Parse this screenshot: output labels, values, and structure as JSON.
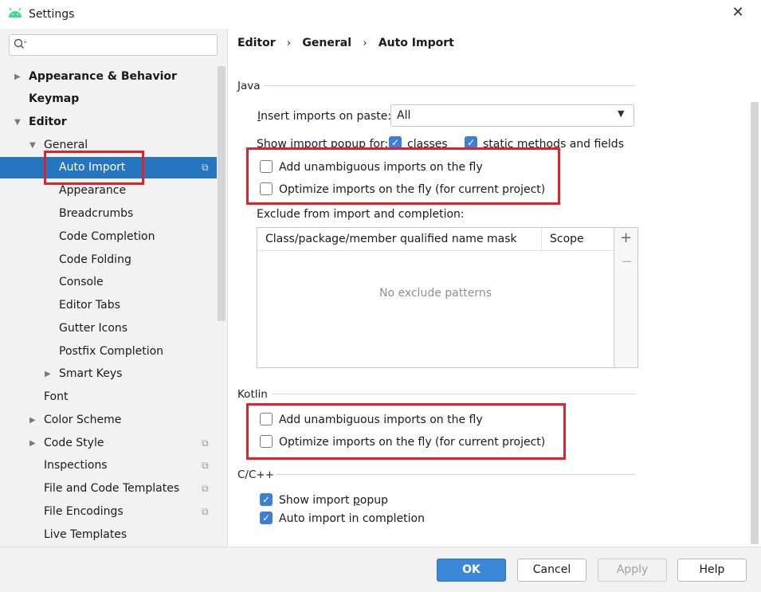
{
  "window": {
    "title": "Settings"
  },
  "search": {
    "placeholder": ""
  },
  "sidebar": {
    "items": [
      {
        "label": "Appearance & Behavior"
      },
      {
        "label": "Keymap"
      },
      {
        "label": "Editor"
      },
      {
        "label": "General"
      },
      {
        "label": "Auto Import"
      },
      {
        "label": "Appearance"
      },
      {
        "label": "Breadcrumbs"
      },
      {
        "label": "Code Completion"
      },
      {
        "label": "Code Folding"
      },
      {
        "label": "Console"
      },
      {
        "label": "Editor Tabs"
      },
      {
        "label": "Gutter Icons"
      },
      {
        "label": "Postfix Completion"
      },
      {
        "label": "Smart Keys"
      },
      {
        "label": "Font"
      },
      {
        "label": "Color Scheme"
      },
      {
        "label": "Code Style"
      },
      {
        "label": "Inspections"
      },
      {
        "label": "File and Code Templates"
      },
      {
        "label": "File Encodings"
      },
      {
        "label": "Live Templates"
      }
    ]
  },
  "breadcrumb": {
    "part1": "Editor",
    "part2": "General",
    "part3": "Auto Import",
    "sep": "›"
  },
  "java": {
    "section": "Java",
    "insert_on_paste_prefix": "I",
    "insert_on_paste_rest": "nsert imports on paste:",
    "insert_on_paste_value": "All",
    "popup_label": "Show import popup for:",
    "popup_classes": "classes",
    "popup_static": "static methods and fields",
    "add_unambiguous": "Add unambiguous imports on the fly",
    "optimize": "Optimize imports on the fly (for current project)",
    "exclude_label": "Exclude from import and completion:",
    "table_col1": "Class/package/member qualified name mask",
    "table_col2": "Scope",
    "table_empty": "No exclude patterns"
  },
  "kotlin": {
    "section": "Kotlin",
    "add_unambiguous": "Add unambiguous imports on the fly",
    "optimize": "Optimize imports on the fly (for current project)"
  },
  "cpp": {
    "section": "C/C++",
    "show_popup_prefix": "Show import ",
    "show_popup_mn": "p",
    "show_popup_rest": "opup",
    "auto_import": "Auto import in completion"
  },
  "footer": {
    "ok": "OK",
    "cancel": "Cancel",
    "apply": "Apply",
    "help": "Help"
  },
  "icons": {
    "plus": "+",
    "minus": "−",
    "check": "✓",
    "close": "✕"
  },
  "colors": {
    "accent": "#2675bf",
    "highlight": "#e3202b"
  }
}
